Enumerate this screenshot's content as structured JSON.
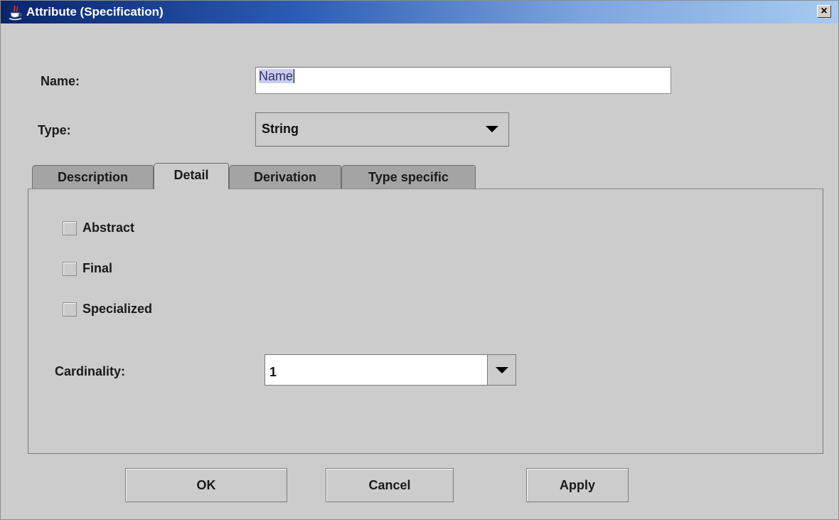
{
  "window": {
    "title": "Attribute (Specification)",
    "close_label": "×"
  },
  "form": {
    "name_label": "Name:",
    "name_value": "Name",
    "type_label": "Type:",
    "type_value": "String"
  },
  "tabs": [
    {
      "label": "Description",
      "active": false
    },
    {
      "label": "Detail",
      "active": true
    },
    {
      "label": "Derivation",
      "active": false
    },
    {
      "label": "Type specific",
      "active": false
    }
  ],
  "detail": {
    "checkboxes": [
      {
        "label": "Abstract",
        "checked": false
      },
      {
        "label": "Final",
        "checked": false
      },
      {
        "label": "Specialized",
        "checked": false
      }
    ],
    "cardinality_label": "Cardinality:",
    "cardinality_value": "1"
  },
  "buttons": {
    "ok": "OK",
    "cancel": "Cancel",
    "apply": "Apply"
  },
  "icons": {
    "title_icon": "java-cup-icon",
    "close_icon": "close-icon",
    "dropdown_icon": "chevron-down-icon"
  },
  "colors": {
    "titlebar_start": "#0a246a",
    "titlebar_end": "#a6caf0",
    "background": "#cccccc",
    "inactive_tab": "#a4a4a4",
    "selection": "#c9ccf0"
  }
}
